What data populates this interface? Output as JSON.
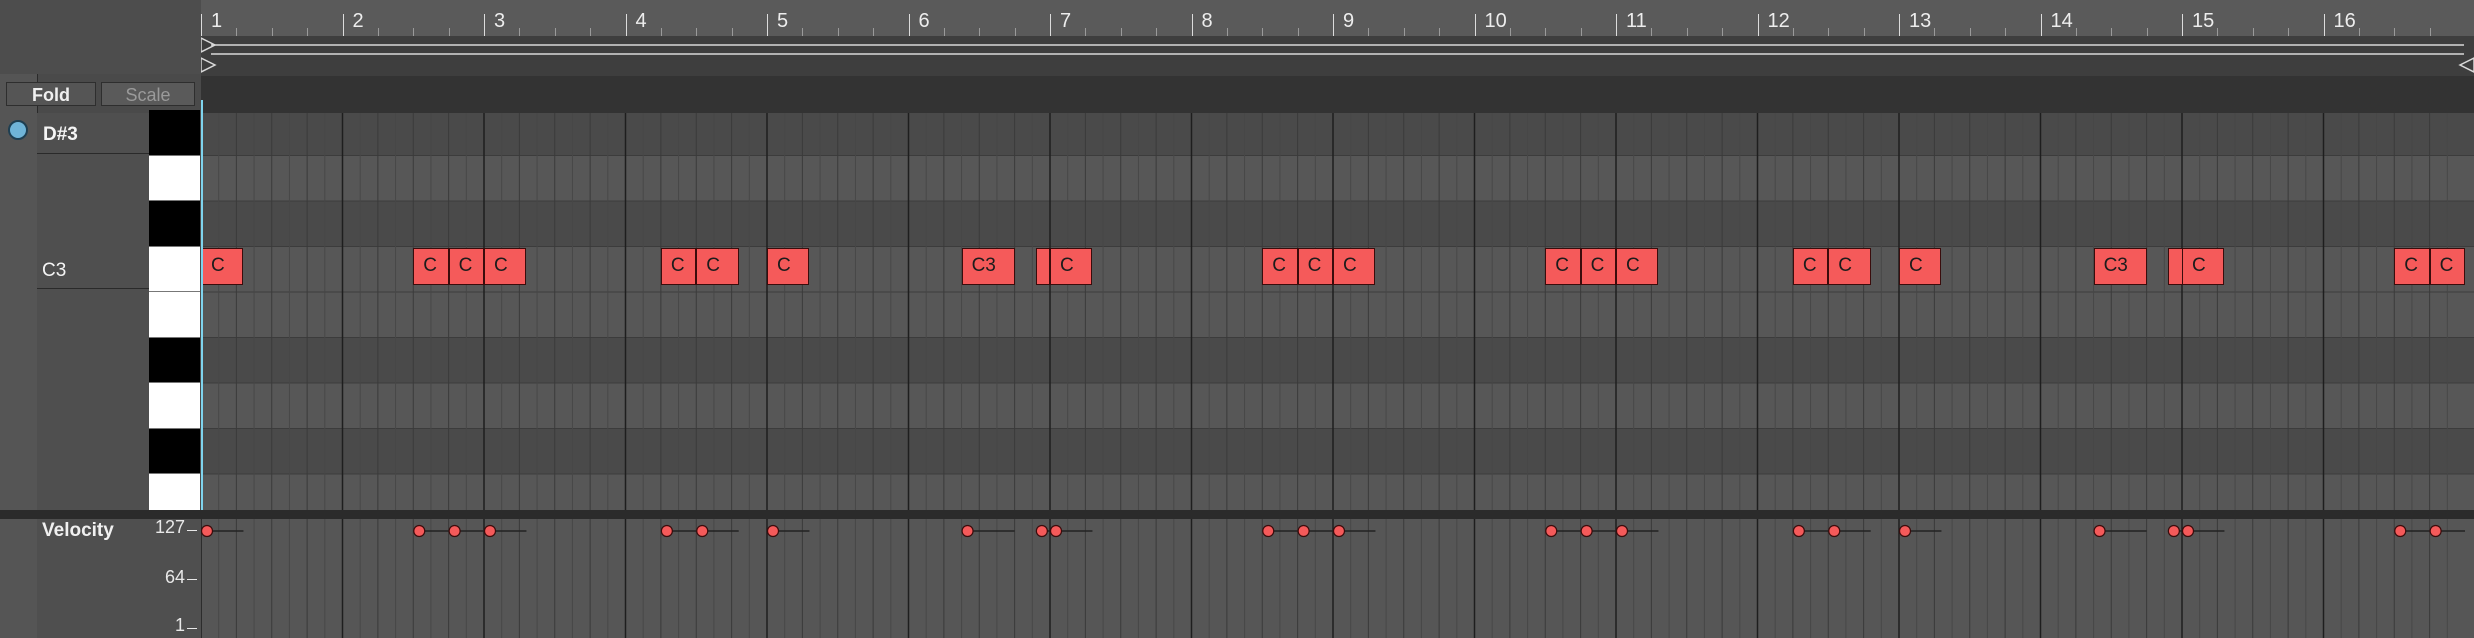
{
  "buttons": {
    "fold": "Fold",
    "scale": "Scale"
  },
  "pitch_labels": {
    "top": "D#3",
    "c3": "C3"
  },
  "ruler": {
    "bars": [
      "1",
      "2",
      "3",
      "4",
      "5",
      "6",
      "7",
      "8",
      "9",
      "10",
      "11",
      "12",
      "13",
      "14",
      "15",
      "16"
    ]
  },
  "velocity": {
    "title": "Velocity",
    "ticks": [
      "127",
      "64",
      "1"
    ],
    "max": 127
  },
  "colors": {
    "note": "#f55a5a",
    "playhead": "#7fd4ee",
    "background": "#4a4a4a"
  },
  "notes": [
    {
      "label": "C",
      "start": 1.0,
      "len": 0.3,
      "velocity": 127
    },
    {
      "label": "C",
      "start": 2.5,
      "len": 0.25,
      "velocity": 127
    },
    {
      "label": "C",
      "start": 2.75,
      "len": 0.25,
      "velocity": 127
    },
    {
      "label": "C",
      "start": 3.0,
      "len": 0.3,
      "velocity": 127
    },
    {
      "label": "C",
      "start": 4.25,
      "len": 0.25,
      "velocity": 127
    },
    {
      "label": "C",
      "start": 4.5,
      "len": 0.3,
      "velocity": 127
    },
    {
      "label": "C",
      "start": 5.0,
      "len": 0.3,
      "velocity": 127
    },
    {
      "label": "C3",
      "start": 6.375,
      "len": 0.375,
      "velocity": 127
    },
    {
      "label": "",
      "start": 6.9,
      "len": 0.1,
      "velocity": 127
    },
    {
      "label": "C",
      "start": 7.0,
      "len": 0.3,
      "velocity": 127
    },
    {
      "label": "C",
      "start": 8.5,
      "len": 0.25,
      "velocity": 127
    },
    {
      "label": "C",
      "start": 8.75,
      "len": 0.25,
      "velocity": 127
    },
    {
      "label": "C",
      "start": 9.0,
      "len": 0.3,
      "velocity": 127
    },
    {
      "label": "C",
      "start": 10.5,
      "len": 0.25,
      "velocity": 127
    },
    {
      "label": "C",
      "start": 10.75,
      "len": 0.25,
      "velocity": 127
    },
    {
      "label": "C",
      "start": 11.0,
      "len": 0.3,
      "velocity": 127
    },
    {
      "label": "C",
      "start": 12.25,
      "len": 0.25,
      "velocity": 127
    },
    {
      "label": "C",
      "start": 12.5,
      "len": 0.3,
      "velocity": 127
    },
    {
      "label": "C",
      "start": 13.0,
      "len": 0.3,
      "velocity": 127
    },
    {
      "label": "C3",
      "start": 14.375,
      "len": 0.375,
      "velocity": 127
    },
    {
      "label": "",
      "start": 14.9,
      "len": 0.125,
      "velocity": 127
    },
    {
      "label": "C",
      "start": 15.0,
      "len": 0.3,
      "velocity": 127
    },
    {
      "label": "C",
      "start": 16.5,
      "len": 0.25,
      "velocity": 127
    },
    {
      "label": "C",
      "start": 16.75,
      "len": 0.25,
      "velocity": 127
    }
  ]
}
